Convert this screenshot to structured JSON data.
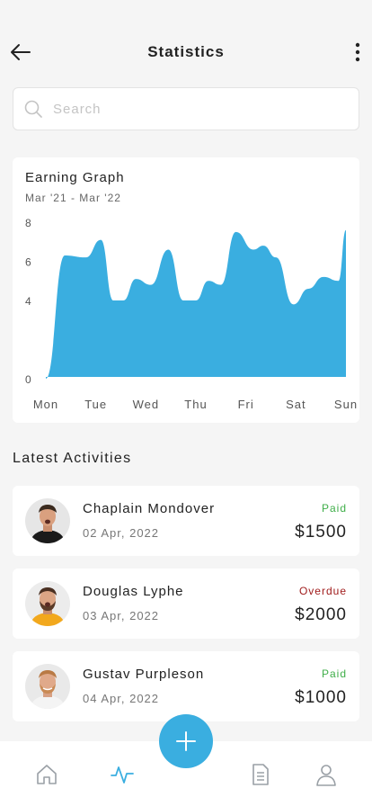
{
  "header": {
    "title": "Statistics",
    "back_icon": "back-arrow-icon",
    "more_icon": "more-vertical-icon"
  },
  "search": {
    "placeholder": "Search",
    "value": ""
  },
  "graph": {
    "title": "Earning Graph",
    "subtitle": "Mar '21 - Mar '22",
    "color": "#3aaee0"
  },
  "chart_data": {
    "type": "area",
    "title": "Earning Graph",
    "subtitle": "Mar '21 - Mar '22",
    "categories": [
      "Mon",
      "Tue",
      "Wed",
      "Thu",
      "Fri",
      "Sat",
      "Sun"
    ],
    "ylim": [
      0,
      8
    ],
    "yticks": [
      0,
      4,
      6,
      8
    ],
    "series": [
      {
        "x": [
          0,
          0.38,
          0.8,
          1.1,
          1.35,
          1.55,
          1.8,
          2.1,
          2.45,
          2.75,
          3.0,
          3.25,
          3.5,
          3.8,
          4.15,
          4.35,
          4.6,
          4.95,
          5.25,
          5.55,
          5.85,
          6.0
        ],
        "values": [
          0,
          6.3,
          6.2,
          7.1,
          4.0,
          4.0,
          5.1,
          4.8,
          6.6,
          4.0,
          4.0,
          5.0,
          4.8,
          7.5,
          6.6,
          6.8,
          6.2,
          3.8,
          4.6,
          5.2,
          5.0,
          7.6
        ]
      }
    ]
  },
  "activities": {
    "title": "Latest Activities",
    "items": [
      {
        "name": "Chaplain Mondover",
        "date": "02 Apr, 2022",
        "status": "Paid",
        "amount": "$1500"
      },
      {
        "name": "Douglas Lyphe",
        "date": "03 Apr, 2022",
        "status": "Overdue",
        "amount": "$2000"
      },
      {
        "name": "Gustav Purpleson",
        "date": "04 Apr, 2022",
        "status": "Paid",
        "amount": "$1000"
      }
    ]
  },
  "colors": {
    "accent": "#3aaee0",
    "paid": "#3fae49",
    "overdue": "#a01c1c",
    "inactive_icon": "#9aa0a6"
  },
  "bottom_nav": {
    "items": [
      "home-icon",
      "activity-icon",
      "add-icon",
      "document-icon",
      "profile-icon"
    ],
    "active": "activity-icon"
  }
}
